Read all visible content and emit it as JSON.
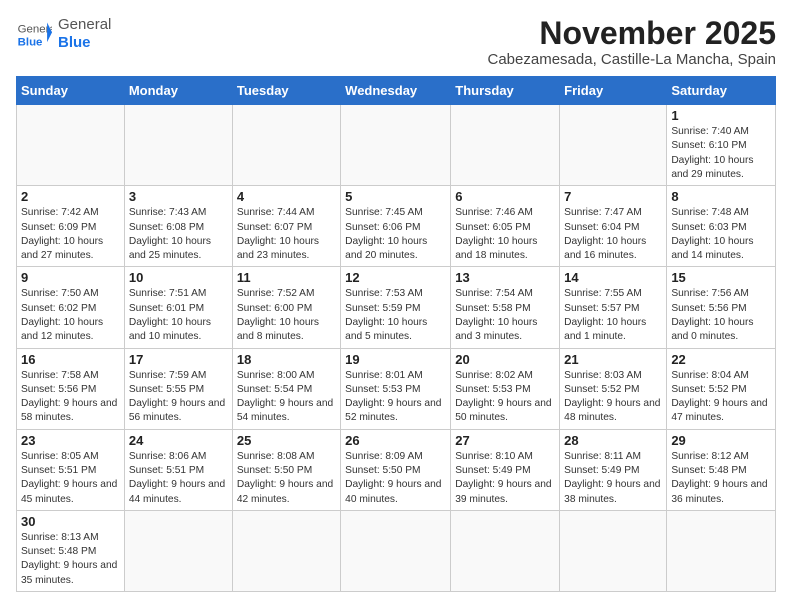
{
  "header": {
    "logo_general": "General",
    "logo_blue": "Blue",
    "month_title": "November 2025",
    "subtitle": "Cabezamesada, Castille-La Mancha, Spain"
  },
  "weekdays": [
    "Sunday",
    "Monday",
    "Tuesday",
    "Wednesday",
    "Thursday",
    "Friday",
    "Saturday"
  ],
  "weeks": [
    [
      {
        "day": "",
        "info": ""
      },
      {
        "day": "",
        "info": ""
      },
      {
        "day": "",
        "info": ""
      },
      {
        "day": "",
        "info": ""
      },
      {
        "day": "",
        "info": ""
      },
      {
        "day": "",
        "info": ""
      },
      {
        "day": "1",
        "info": "Sunrise: 7:40 AM\nSunset: 6:10 PM\nDaylight: 10 hours and 29 minutes."
      }
    ],
    [
      {
        "day": "2",
        "info": "Sunrise: 7:42 AM\nSunset: 6:09 PM\nDaylight: 10 hours and 27 minutes."
      },
      {
        "day": "3",
        "info": "Sunrise: 7:43 AM\nSunset: 6:08 PM\nDaylight: 10 hours and 25 minutes."
      },
      {
        "day": "4",
        "info": "Sunrise: 7:44 AM\nSunset: 6:07 PM\nDaylight: 10 hours and 23 minutes."
      },
      {
        "day": "5",
        "info": "Sunrise: 7:45 AM\nSunset: 6:06 PM\nDaylight: 10 hours and 20 minutes."
      },
      {
        "day": "6",
        "info": "Sunrise: 7:46 AM\nSunset: 6:05 PM\nDaylight: 10 hours and 18 minutes."
      },
      {
        "day": "7",
        "info": "Sunrise: 7:47 AM\nSunset: 6:04 PM\nDaylight: 10 hours and 16 minutes."
      },
      {
        "day": "8",
        "info": "Sunrise: 7:48 AM\nSunset: 6:03 PM\nDaylight: 10 hours and 14 minutes."
      }
    ],
    [
      {
        "day": "9",
        "info": "Sunrise: 7:50 AM\nSunset: 6:02 PM\nDaylight: 10 hours and 12 minutes."
      },
      {
        "day": "10",
        "info": "Sunrise: 7:51 AM\nSunset: 6:01 PM\nDaylight: 10 hours and 10 minutes."
      },
      {
        "day": "11",
        "info": "Sunrise: 7:52 AM\nSunset: 6:00 PM\nDaylight: 10 hours and 8 minutes."
      },
      {
        "day": "12",
        "info": "Sunrise: 7:53 AM\nSunset: 5:59 PM\nDaylight: 10 hours and 5 minutes."
      },
      {
        "day": "13",
        "info": "Sunrise: 7:54 AM\nSunset: 5:58 PM\nDaylight: 10 hours and 3 minutes."
      },
      {
        "day": "14",
        "info": "Sunrise: 7:55 AM\nSunset: 5:57 PM\nDaylight: 10 hours and 1 minute."
      },
      {
        "day": "15",
        "info": "Sunrise: 7:56 AM\nSunset: 5:56 PM\nDaylight: 10 hours and 0 minutes."
      }
    ],
    [
      {
        "day": "16",
        "info": "Sunrise: 7:58 AM\nSunset: 5:56 PM\nDaylight: 9 hours and 58 minutes."
      },
      {
        "day": "17",
        "info": "Sunrise: 7:59 AM\nSunset: 5:55 PM\nDaylight: 9 hours and 56 minutes."
      },
      {
        "day": "18",
        "info": "Sunrise: 8:00 AM\nSunset: 5:54 PM\nDaylight: 9 hours and 54 minutes."
      },
      {
        "day": "19",
        "info": "Sunrise: 8:01 AM\nSunset: 5:53 PM\nDaylight: 9 hours and 52 minutes."
      },
      {
        "day": "20",
        "info": "Sunrise: 8:02 AM\nSunset: 5:53 PM\nDaylight: 9 hours and 50 minutes."
      },
      {
        "day": "21",
        "info": "Sunrise: 8:03 AM\nSunset: 5:52 PM\nDaylight: 9 hours and 48 minutes."
      },
      {
        "day": "22",
        "info": "Sunrise: 8:04 AM\nSunset: 5:52 PM\nDaylight: 9 hours and 47 minutes."
      }
    ],
    [
      {
        "day": "23",
        "info": "Sunrise: 8:05 AM\nSunset: 5:51 PM\nDaylight: 9 hours and 45 minutes."
      },
      {
        "day": "24",
        "info": "Sunrise: 8:06 AM\nSunset: 5:51 PM\nDaylight: 9 hours and 44 minutes."
      },
      {
        "day": "25",
        "info": "Sunrise: 8:08 AM\nSunset: 5:50 PM\nDaylight: 9 hours and 42 minutes."
      },
      {
        "day": "26",
        "info": "Sunrise: 8:09 AM\nSunset: 5:50 PM\nDaylight: 9 hours and 40 minutes."
      },
      {
        "day": "27",
        "info": "Sunrise: 8:10 AM\nSunset: 5:49 PM\nDaylight: 9 hours and 39 minutes."
      },
      {
        "day": "28",
        "info": "Sunrise: 8:11 AM\nSunset: 5:49 PM\nDaylight: 9 hours and 38 minutes."
      },
      {
        "day": "29",
        "info": "Sunrise: 8:12 AM\nSunset: 5:48 PM\nDaylight: 9 hours and 36 minutes."
      }
    ],
    [
      {
        "day": "30",
        "info": "Sunrise: 8:13 AM\nSunset: 5:48 PM\nDaylight: 9 hours and 35 minutes."
      },
      {
        "day": "",
        "info": ""
      },
      {
        "day": "",
        "info": ""
      },
      {
        "day": "",
        "info": ""
      },
      {
        "day": "",
        "info": ""
      },
      {
        "day": "",
        "info": ""
      },
      {
        "day": "",
        "info": ""
      }
    ]
  ]
}
